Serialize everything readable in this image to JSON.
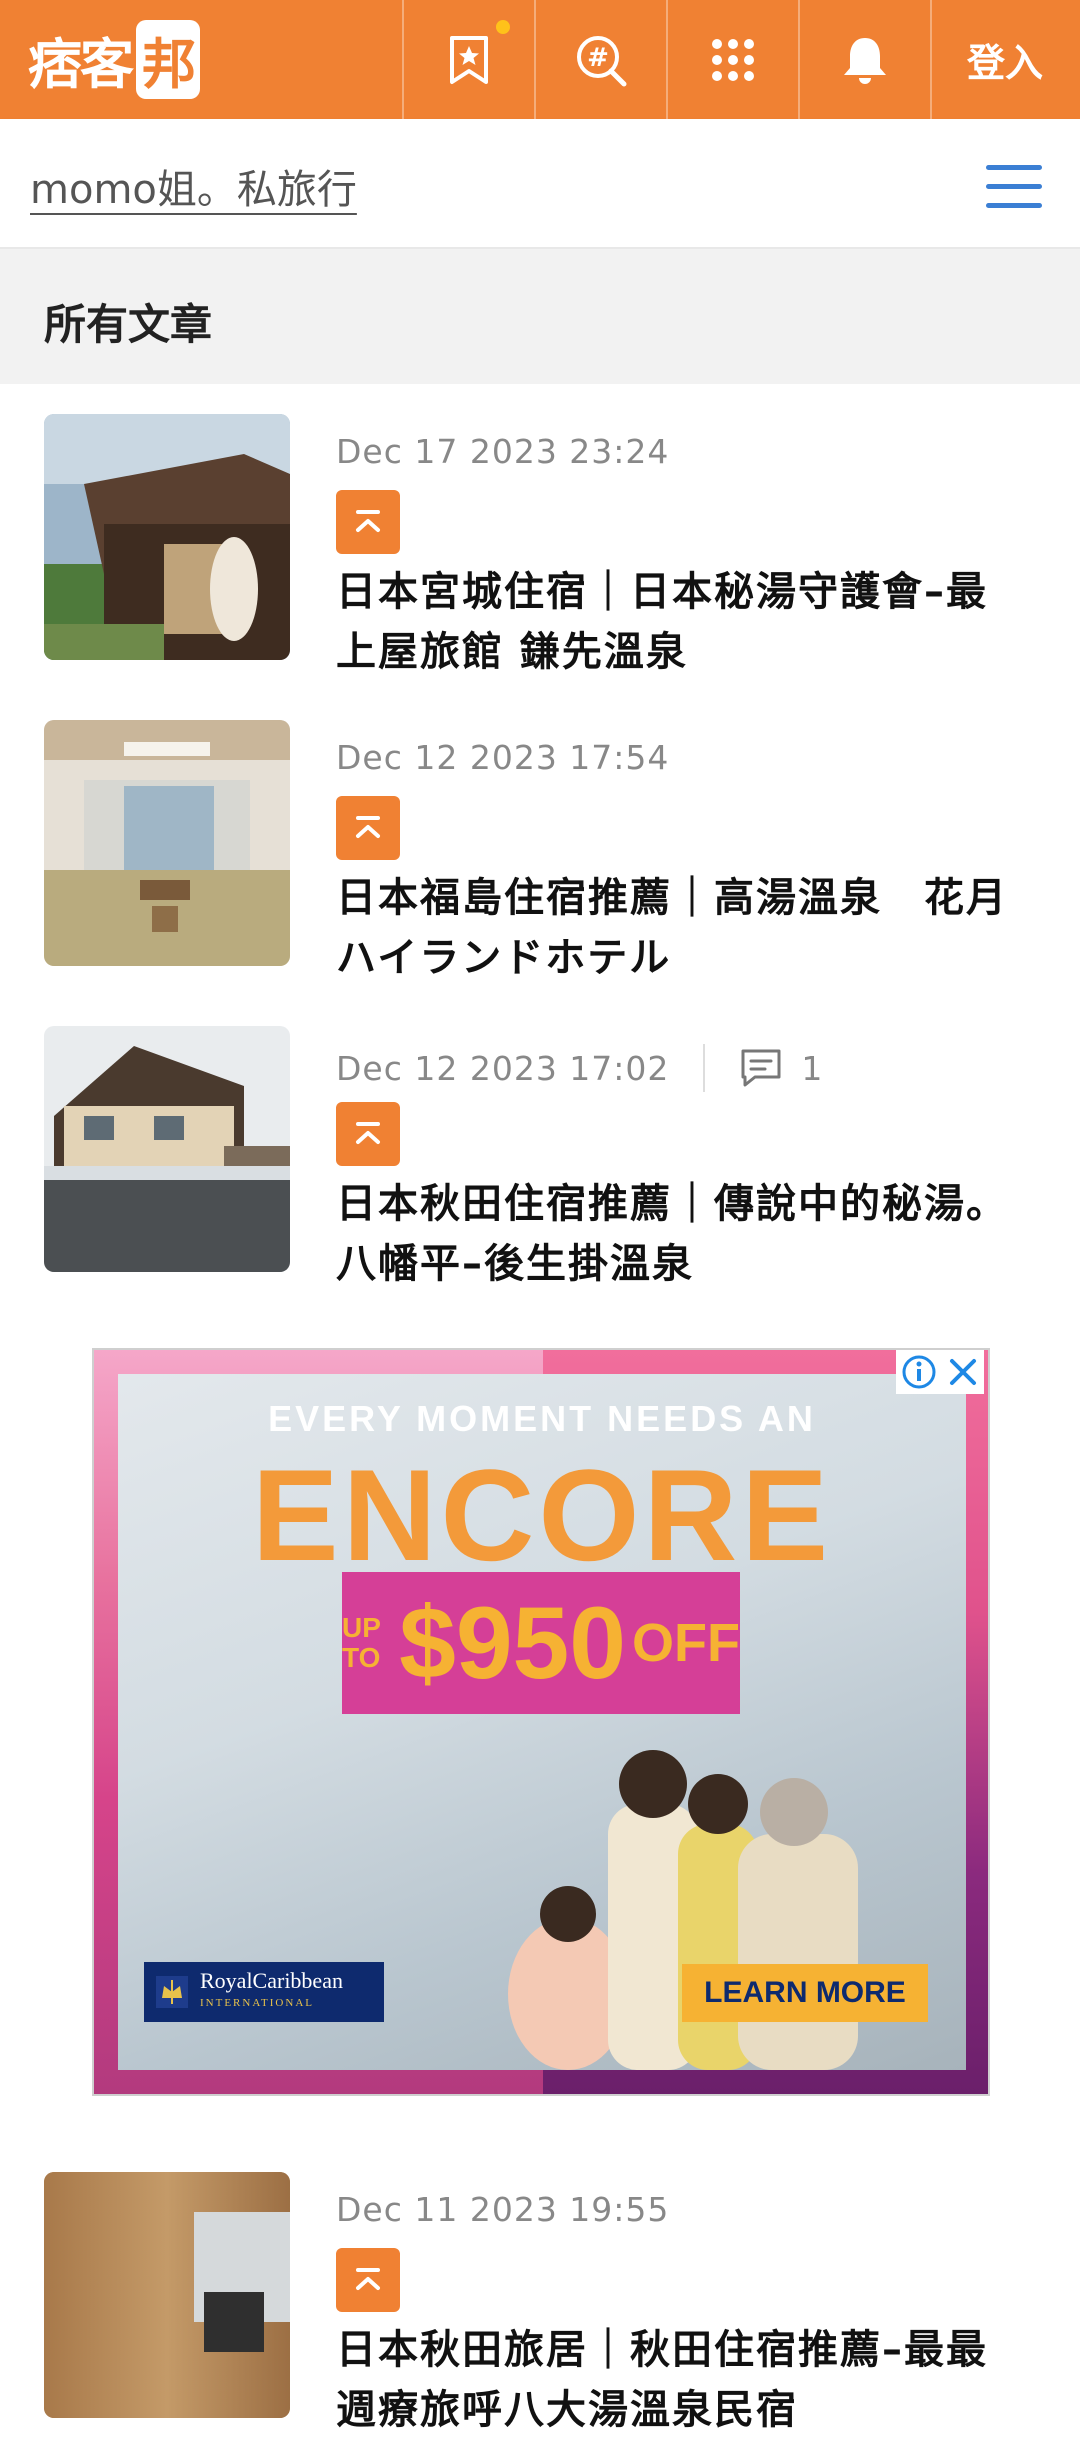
{
  "topbar": {
    "logo_text": "痞客",
    "logo_badge": "邦",
    "icons": [
      "bookmark-star-icon",
      "hashtag-search-icon",
      "grid-icon",
      "bell-icon"
    ],
    "login_label": "登入",
    "accent": "#F08133"
  },
  "blog": {
    "title": "momo姐。私旅行",
    "menu_icon": "hamburger-icon"
  },
  "section": {
    "title": "所有文章"
  },
  "articles": [
    {
      "date": "Dec 17 2023 23:24",
      "title": "日本宮城住宿｜日本秘湯守護會–最上屋旅館 鎌先溫泉",
      "comments": ""
    },
    {
      "date": "Dec 12 2023 17:54",
      "title": "日本福島住宿推薦｜高湯溫泉　花月ハイランドホテル",
      "comments": ""
    },
    {
      "date": "Dec 12 2023 17:02",
      "title": "日本秋田住宿推薦｜傳說中的秘湯。八幡平–後生掛溫泉",
      "comments": "1"
    },
    {
      "date": "Dec 11 2023 19:55",
      "title": "日本秋田旅居｜秋田住宿推薦–最最週療旅呼八大湯溫泉民宿",
      "comments": ""
    }
  ],
  "ad": {
    "headline": "EVERY MOMENT NEEDS AN",
    "encore": "ENCORE",
    "upto": "UP TO",
    "amount": "$950",
    "off": "OFF",
    "brand": "RoyalCaribbean",
    "brand_sub": "INTERNATIONAL",
    "cta": "LEARN MORE"
  }
}
